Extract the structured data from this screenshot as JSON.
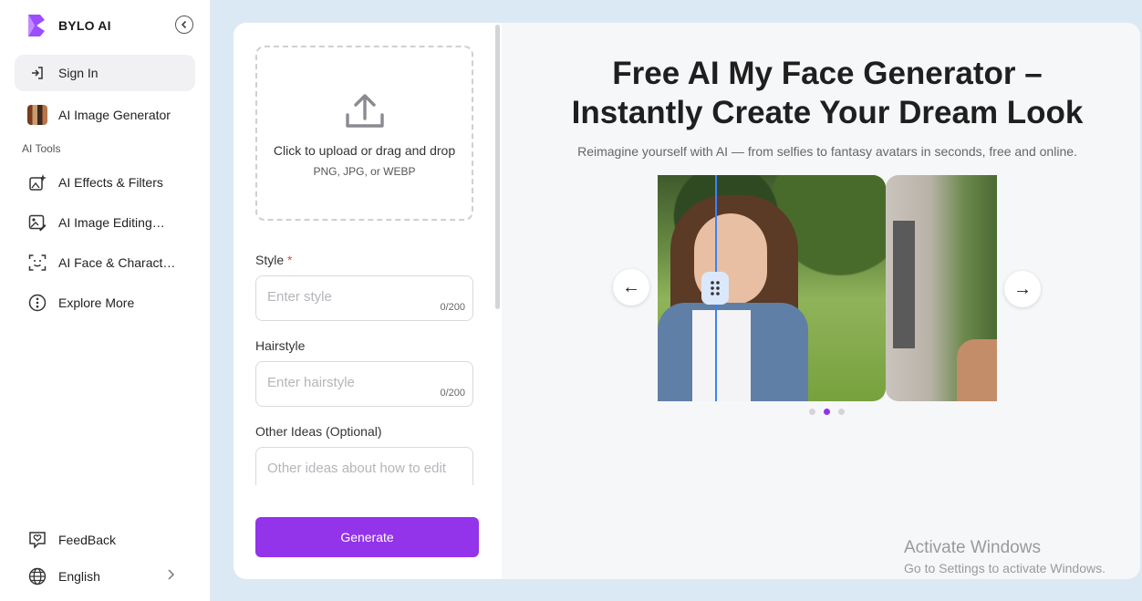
{
  "brand": {
    "name": "BYLO AI"
  },
  "sidebar": {
    "sign_in": "Sign In",
    "image_generator": "AI Image Generator",
    "section_label": "AI Tools",
    "items": [
      {
        "label": "AI Effects & Filters",
        "icon": "sparkle-image-icon"
      },
      {
        "label": "AI Image Editing…",
        "icon": "image-edit-icon"
      },
      {
        "label": "AI Face & Charact…",
        "icon": "face-scan-icon"
      },
      {
        "label": "Explore More",
        "icon": "more-circle-icon"
      }
    ],
    "feedback": "FeedBack",
    "language": "English"
  },
  "upload": {
    "title": "Click to upload or drag and drop",
    "formats": "PNG, JPG, or WEBP"
  },
  "form": {
    "style": {
      "label": "Style",
      "required_mark": "*",
      "placeholder": "Enter style",
      "counter": "0/200"
    },
    "hairstyle": {
      "label": "Hairstyle",
      "placeholder": "Enter hairstyle",
      "counter": "0/200"
    },
    "other": {
      "label": "Other Ideas (Optional)",
      "placeholder": "Other ideas about how to edit"
    },
    "generate_label": "Generate"
  },
  "hero": {
    "title_line1": "Free AI My Face Generator –",
    "title_line2": "Instantly Create Your Dream Look",
    "subtitle": "Reimagine yourself with AI — from selfies to fantasy avatars in seconds, free and online."
  },
  "carousel": {
    "prev": "←",
    "next": "→",
    "active_index": 1,
    "count": 3
  },
  "watermark": {
    "line1": "Activate Windows",
    "line2": "Go to Settings to activate Windows."
  },
  "colors": {
    "accent": "#9333ea",
    "divider": "#3b82f6"
  }
}
